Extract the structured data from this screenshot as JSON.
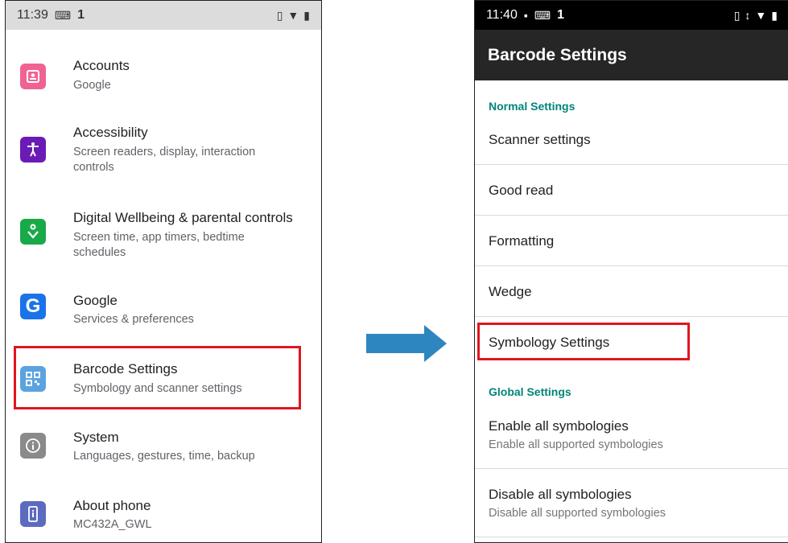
{
  "left_screen": {
    "status": {
      "time": "11:39",
      "notif_count": "1"
    },
    "items": [
      {
        "title": "Accounts",
        "subtitle": "Google",
        "icon": "accounts-icon",
        "color": "#f06292"
      },
      {
        "title": "Accessibility",
        "subtitle": "Screen readers, display, interaction controls",
        "icon": "accessibility-icon",
        "color": "#6a1bb5"
      },
      {
        "title": "Digital Wellbeing & parental controls",
        "subtitle": "Screen time, app timers, bedtime schedules",
        "icon": "wellbeing-icon",
        "color": "#1aa949"
      },
      {
        "title": "Google",
        "subtitle": "Services & preferences",
        "icon": "google-icon",
        "color": "#1a73e8"
      },
      {
        "title": "Barcode Settings",
        "subtitle": "Symbology and scanner settings",
        "icon": "barcode-icon",
        "color": "#5ba3e0"
      },
      {
        "title": "System",
        "subtitle": "Languages, gestures, time, backup",
        "icon": "info-icon",
        "color": "#8a8a8a"
      },
      {
        "title": "About phone",
        "subtitle": "MC432A_GWL",
        "icon": "phone-icon",
        "color": "#5c6bc0"
      }
    ]
  },
  "right_screen": {
    "status": {
      "time": "11:40",
      "notif_count": "1"
    },
    "title": "Barcode Settings",
    "normal_header": "Normal Settings",
    "normal_items": [
      "Scanner settings",
      "Good read",
      "Formatting",
      "Wedge",
      "Symbology Settings"
    ],
    "global_header": "Global Settings",
    "global_items": [
      {
        "title": "Enable all symbologies",
        "subtitle": "Enable all supported symbologies"
      },
      {
        "title": "Disable all symbologies",
        "subtitle": "Disable all supported symbologies"
      }
    ]
  },
  "colors": {
    "highlight": "#e0161f",
    "arrow": "#2e86c1",
    "section_header": "#008577"
  }
}
